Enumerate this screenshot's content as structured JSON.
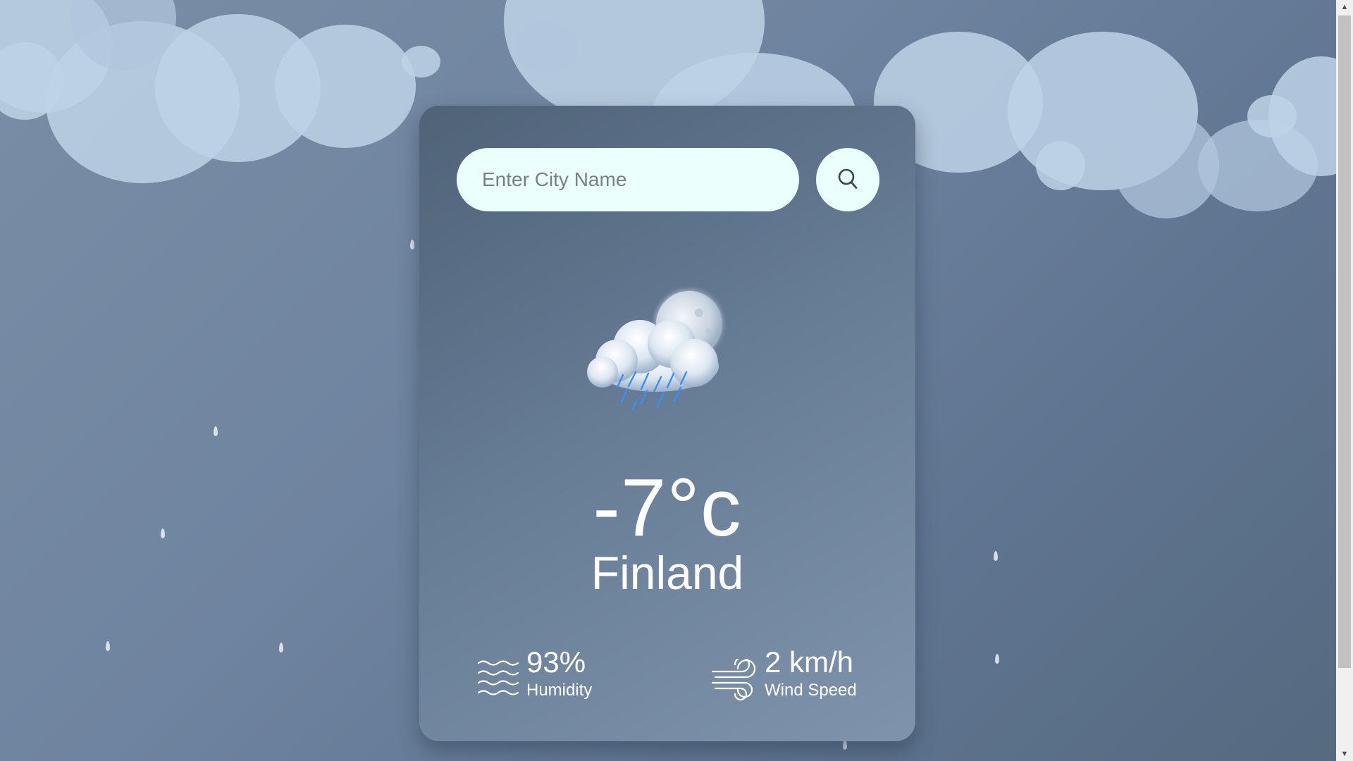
{
  "search": {
    "placeholder": "Enter City Name",
    "value": "",
    "button_icon": "search-icon"
  },
  "weather": {
    "icon": "cloud-moon-rain-icon",
    "temperature": "-7°c",
    "city": "Finland"
  },
  "details": {
    "humidity": {
      "icon": "humidity-waves-icon",
      "value": "93%",
      "label": "Humidity"
    },
    "wind": {
      "icon": "wind-icon",
      "value": "2 km/h",
      "label": "Wind Speed"
    }
  },
  "colors": {
    "background": "#6f84a0",
    "card": "#667b94",
    "input_background": "#ebfffc",
    "text": "#ffffff",
    "rain": "#3a8dff"
  }
}
